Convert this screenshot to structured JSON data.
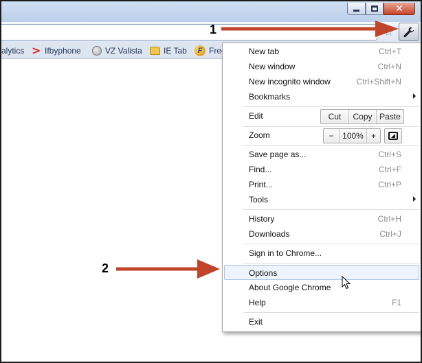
{
  "window": {
    "controls": {
      "minimize": "minimize",
      "maximize": "restore",
      "close": "close"
    }
  },
  "toolbar": {
    "star_icon": "bookmark-star-icon",
    "wrench_icon": "wrench-icon"
  },
  "bookmarks": [
    {
      "label": "alytics",
      "icon": "none"
    },
    {
      "label": "Ifbyphone",
      "icon": "ifbyphone-chevron-icon"
    },
    {
      "label": "VZ Valista",
      "icon": "globe-icon"
    },
    {
      "label": "IE Tab",
      "icon": "folder-icon"
    },
    {
      "label": "Free",
      "icon": "firefox-like-icon"
    }
  ],
  "menu": {
    "new_tab": {
      "label": "New tab",
      "shortcut": "Ctrl+T"
    },
    "new_window": {
      "label": "New window",
      "shortcut": "Ctrl+N"
    },
    "new_incognito": {
      "label": "New incognito window",
      "shortcut": "Ctrl+Shift+N"
    },
    "bookmarks": {
      "label": "Bookmarks"
    },
    "edit": {
      "label": "Edit",
      "cut": "Cut",
      "copy": "Copy",
      "paste": "Paste"
    },
    "zoom": {
      "label": "Zoom",
      "minus": "−",
      "value": "100%",
      "plus": "+"
    },
    "save_page": {
      "label": "Save page as...",
      "shortcut": "Ctrl+S"
    },
    "find": {
      "label": "Find...",
      "shortcut": "Ctrl+F"
    },
    "print": {
      "label": "Print...",
      "shortcut": "Ctrl+P"
    },
    "tools": {
      "label": "Tools"
    },
    "history": {
      "label": "History",
      "shortcut": "Ctrl+H"
    },
    "downloads": {
      "label": "Downloads",
      "shortcut": "Ctrl+J"
    },
    "sign_in": {
      "label": "Sign in to Chrome..."
    },
    "options": {
      "label": "Options"
    },
    "about": {
      "label": "About Google Chrome"
    },
    "help": {
      "label": "Help",
      "shortcut": "F1"
    },
    "exit": {
      "label": "Exit"
    }
  },
  "annotations": {
    "step1": "1",
    "step2": "2",
    "arrow_color": "#c0432a"
  },
  "colors": {
    "titlebar": "#c5d7ee",
    "menu_highlight": "#eef4fd",
    "shortcut_text": "#8a8a8a"
  }
}
